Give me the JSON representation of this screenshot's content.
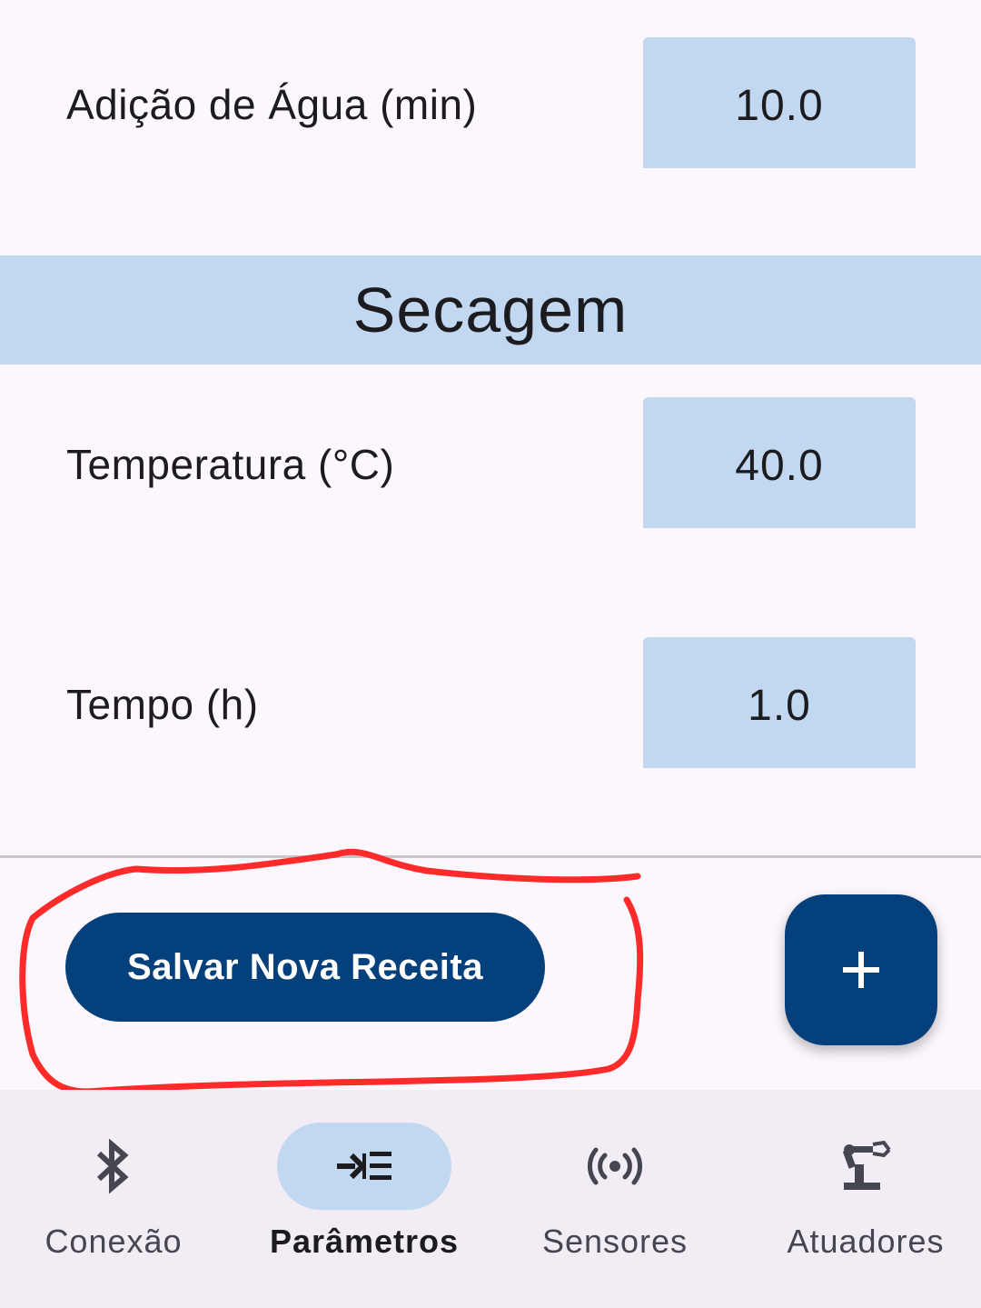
{
  "params_top": [
    {
      "label": "Adição de Água (min)",
      "value": "10.0"
    }
  ],
  "section": {
    "title": "Secagem"
  },
  "params_secagem": [
    {
      "label": "Temperatura (°C)",
      "value": "40.0"
    },
    {
      "label": "Tempo (h)",
      "value": "1.0"
    }
  ],
  "actions": {
    "save_label": "Salvar Nova Receita",
    "fab_icon": "plus-icon"
  },
  "bottom_nav": {
    "items": [
      {
        "label": "Conexão",
        "icon": "bluetooth-icon",
        "active": false
      },
      {
        "label": "Parâmetros",
        "icon": "parameters-icon",
        "active": true
      },
      {
        "label": "Sensores",
        "icon": "sensors-icon",
        "active": false
      },
      {
        "label": "Atuadores",
        "icon": "robot-arm-icon",
        "active": false
      }
    ]
  },
  "colors": {
    "background": "#fcf7fc",
    "field_background": "#c1d8f0",
    "primary": "#04407c",
    "nav_background": "#f2ecf4",
    "annotation": "#ff2a2a"
  }
}
